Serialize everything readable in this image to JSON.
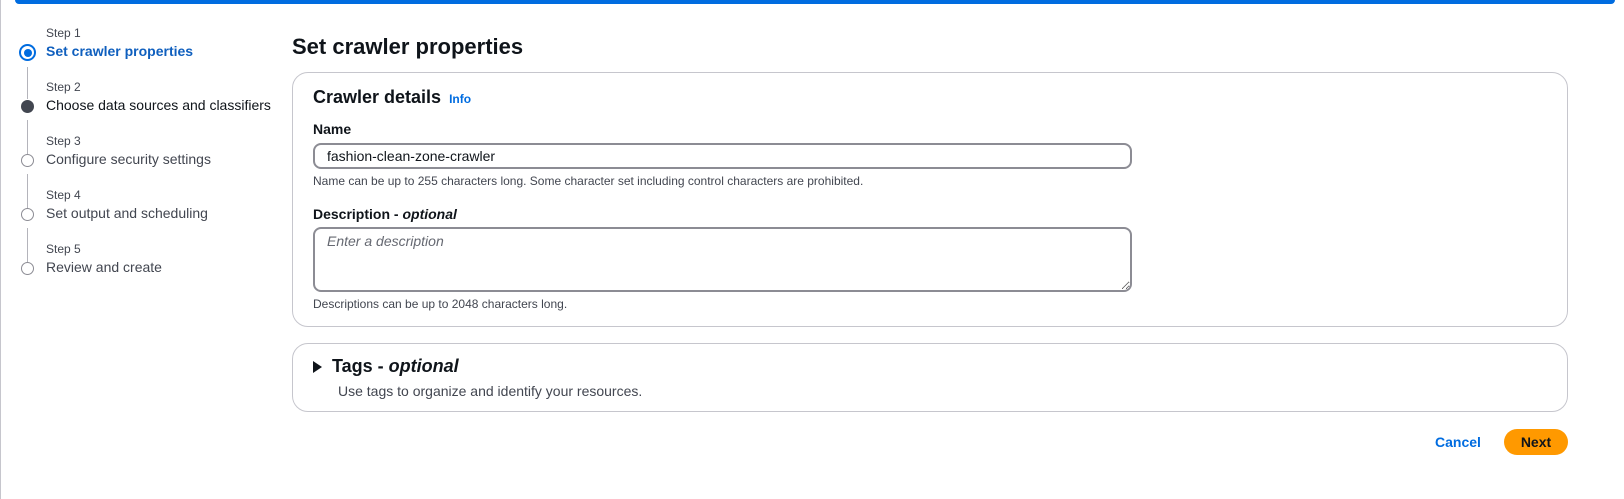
{
  "wizard": {
    "steps": [
      {
        "number": "Step 1",
        "title": "Set crawler properties",
        "state": "active"
      },
      {
        "number": "Step 2",
        "title": "Choose data sources and classifiers",
        "state": "done"
      },
      {
        "number": "Step 3",
        "title": "Configure security settings",
        "state": "pending"
      },
      {
        "number": "Step 4",
        "title": "Set output and scheduling",
        "state": "pending"
      },
      {
        "number": "Step 5",
        "title": "Review and create",
        "state": "pending"
      }
    ]
  },
  "page": {
    "title": "Set crawler properties"
  },
  "crawler_details": {
    "heading": "Crawler details",
    "info_label": "Info",
    "name_label": "Name",
    "name_value": "fashion-clean-zone-crawler",
    "name_constraint": "Name can be up to 255 characters long. Some character set including control characters are prohibited.",
    "description_label": "Description - ",
    "description_optional": "optional",
    "description_placeholder": "Enter a description",
    "description_value": "",
    "description_constraint": "Descriptions can be up to 2048 characters long."
  },
  "tags": {
    "heading": "Tags - ",
    "heading_optional": "optional",
    "description": "Use tags to organize and identify your resources."
  },
  "actions": {
    "cancel_label": "Cancel",
    "next_label": "Next"
  },
  "colors": {
    "accent": "#006ce0",
    "primary_button": "#ff9900"
  }
}
